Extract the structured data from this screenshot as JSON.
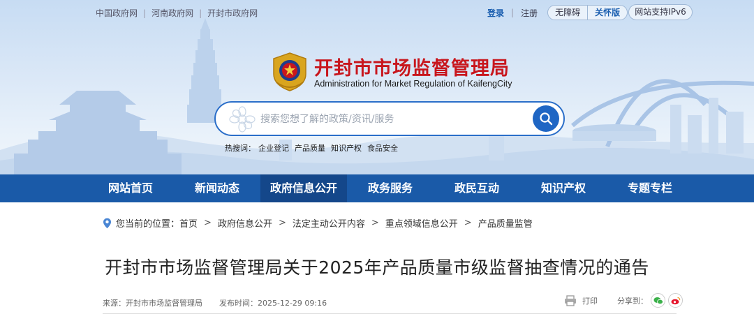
{
  "top_links": [
    "中国政府网",
    "河南政府网",
    "开封市政府网"
  ],
  "user_bar": {
    "login": "登录",
    "register": "注册",
    "accessibility": "无障碍",
    "care_mode": "关怀版",
    "ipv6": "网站支持IPv6"
  },
  "site": {
    "title": "开封市市场监督管理局",
    "subtitle": "Administration for Market Regulation of KaifengCity"
  },
  "search": {
    "placeholder": "搜索您想了解的政策/资讯/服务",
    "icon": "search-icon"
  },
  "hot_words": {
    "label": "热搜词：",
    "items": [
      "企业登记",
      "产品质量",
      "知识产权",
      "食品安全"
    ]
  },
  "nav": {
    "items": [
      "网站首页",
      "新闻动态",
      "政府信息公开",
      "政务服务",
      "政民互动",
      "知识产权",
      "专题专栏"
    ],
    "active_index": 2
  },
  "breadcrumb": {
    "prefix": "您当前的位置：",
    "items": [
      "首页",
      "政府信息公开",
      "法定主动公开内容",
      "重点领域信息公开",
      "产品质量监管"
    ]
  },
  "article": {
    "title": "开封市市场监督管理局关于2025年产品质量市级监督抽查情况的通告",
    "source": "来源：开封市市场监督管理局",
    "published": "发布时间：2025-12-29 09:16",
    "print": "打印",
    "share": "分享到："
  },
  "colors": {
    "brand_red": "#c8161d",
    "nav_blue": "#1a5aa8",
    "nav_active": "#14478a",
    "accent_blue": "#1f66c4"
  }
}
